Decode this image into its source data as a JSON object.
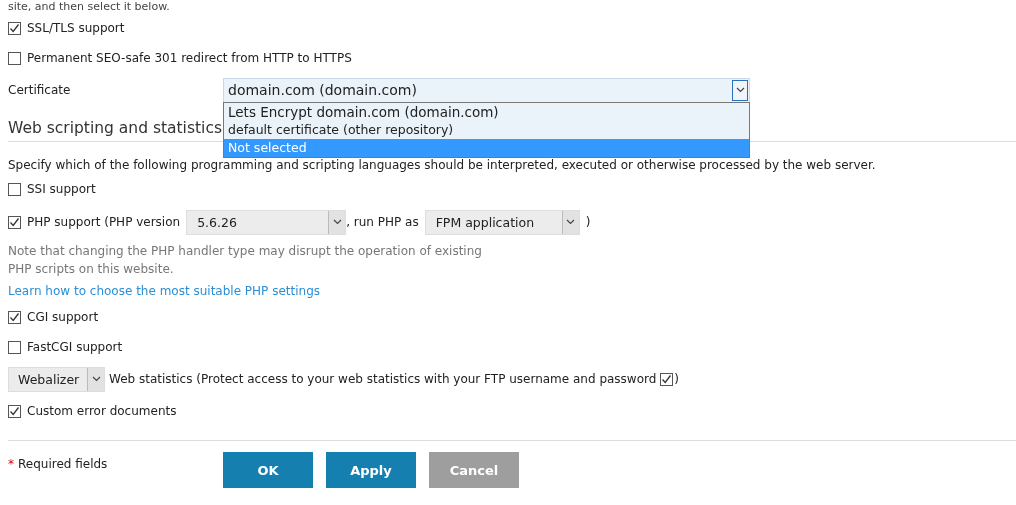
{
  "intro": "site, and then select it below.",
  "ssl": {
    "label": "SSL/TLS support",
    "checked": true
  },
  "redirect": {
    "label": "Permanent SEO-safe 301 redirect from HTTP to HTTPS",
    "checked": false
  },
  "certificate": {
    "label": "Certificate",
    "value": "domain.com (domain.com)",
    "expanded": true,
    "options": [
      {
        "label": "Lets Encrypt domain.com (domain.com)",
        "selected": false
      },
      {
        "label": "default certificate (other repository)",
        "selected": false
      },
      {
        "label": "Not selected",
        "selected": true
      }
    ]
  },
  "scripting": {
    "heading": "Web scripting and statistics",
    "description": "Specify which of the following programming and scripting languages should be interpreted, executed or otherwise processed by the web server.",
    "items": [
      {
        "kind": "checkbox",
        "label": "SSI support",
        "checked": false
      },
      {
        "kind": "php",
        "label": "PHP support (PHP version",
        "checked": true,
        "version": "5.6.26",
        "middle": ", run PHP as",
        "handler": "FPM application",
        "suffix": ")"
      },
      {
        "kind": "note",
        "text": "Note that changing the PHP handler type may disrupt the operation of existing PHP scripts on this website."
      },
      {
        "kind": "link",
        "text": "Learn how to choose the most suitable PHP settings"
      },
      {
        "kind": "checkbox",
        "label": "CGI support",
        "checked": true
      },
      {
        "kind": "checkbox",
        "label": "FastCGI support",
        "checked": false
      },
      {
        "kind": "stats",
        "value": "Webalizer",
        "label": "Web statistics (Protect access to your web statistics with your FTP username and password",
        "checked": true,
        "suffix": ")"
      },
      {
        "kind": "checkbox",
        "label": "Custom error documents",
        "checked": true
      }
    ]
  },
  "footer": {
    "required_mark": "*",
    "required_label": "Required fields",
    "buttons": [
      {
        "label": "OK",
        "kind": "primary"
      },
      {
        "label": "Apply",
        "kind": "primary"
      },
      {
        "label": "Cancel",
        "kind": "neutral"
      }
    ]
  }
}
